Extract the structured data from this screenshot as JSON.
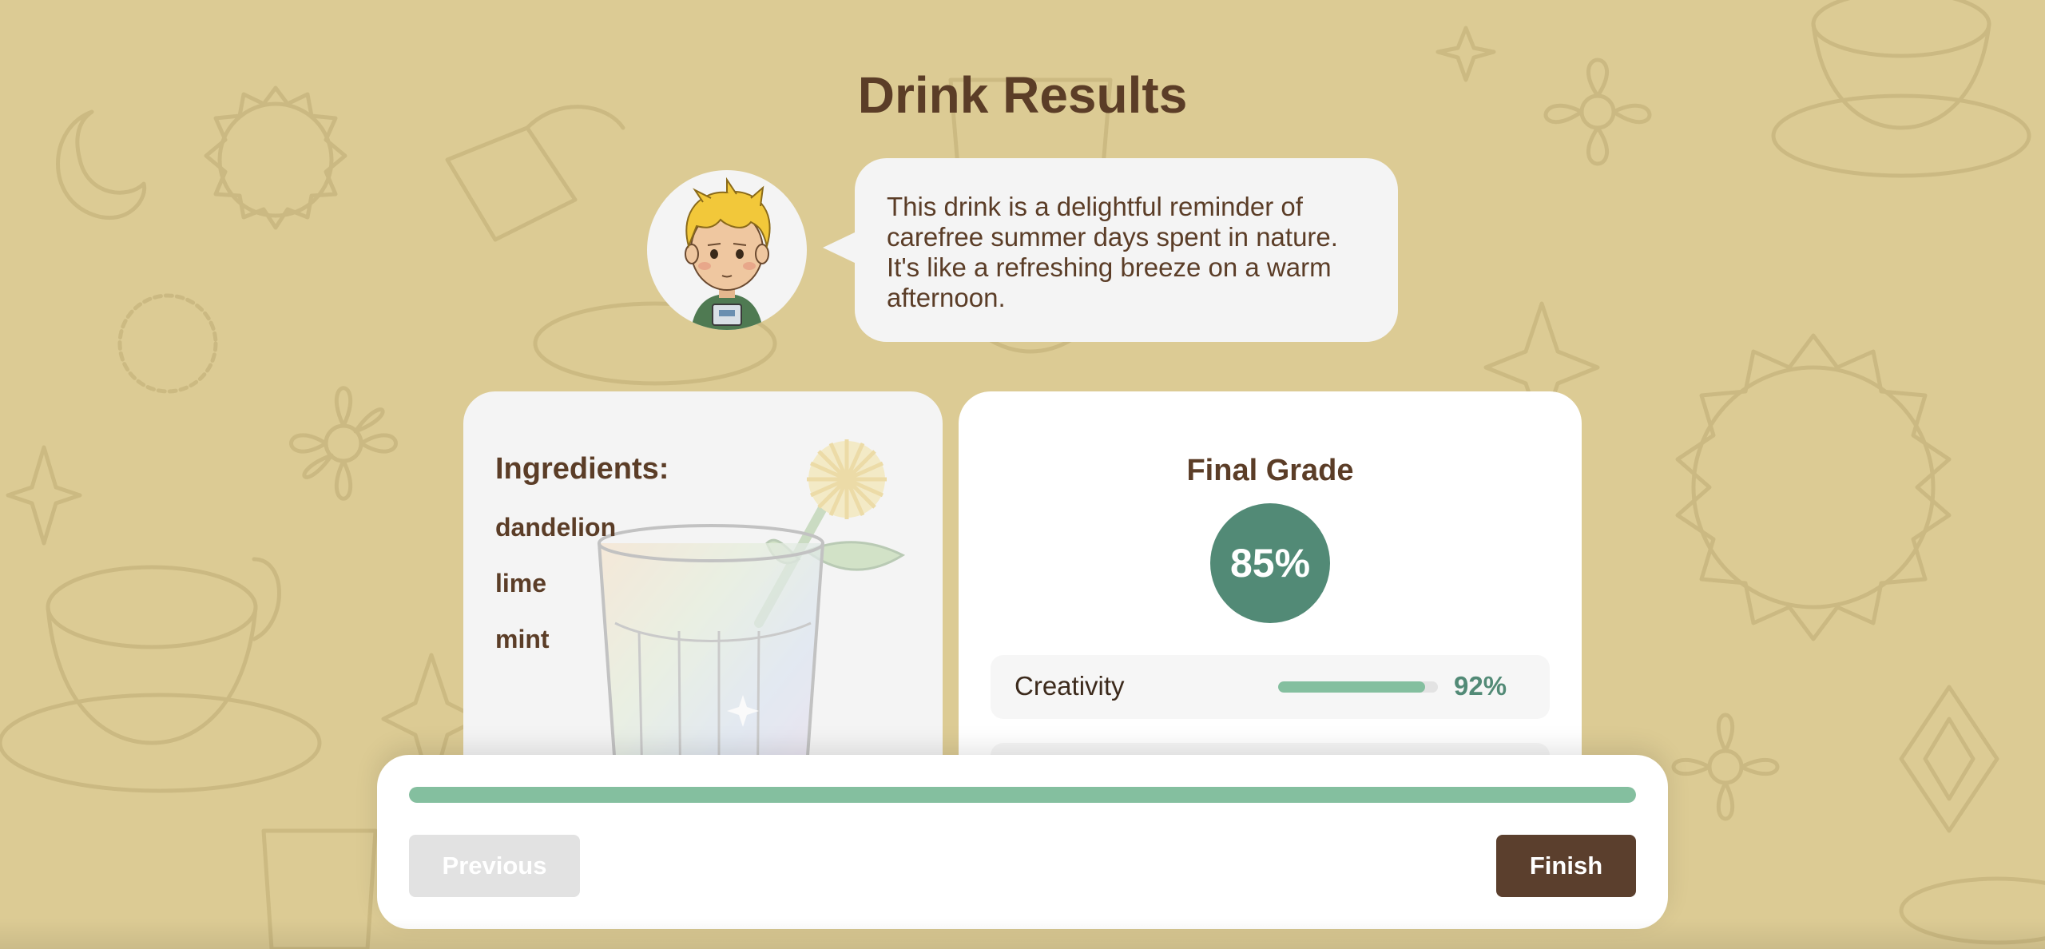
{
  "page": {
    "title": "Drink Results"
  },
  "reviewer": {
    "comment": "This drink is a delightful reminder of carefree summer days spent in nature. It's like a refreshing breeze on a warm afternoon."
  },
  "ingredients": {
    "heading": "Ingredients:",
    "items": [
      "dandelion",
      "lime",
      "mint"
    ]
  },
  "grade": {
    "heading": "Final Grade",
    "value": "85%",
    "criteria": [
      {
        "label": "Creativity",
        "value": "92%",
        "fraction": 0.92
      }
    ]
  },
  "footer": {
    "progress_fraction": 1.0,
    "previous_label": "Previous",
    "finish_label": "Finish"
  },
  "colors": {
    "background": "#dccb94",
    "accent_green": "#528a76",
    "bar_green": "#84bf9f",
    "brown": "#5b3f2d"
  }
}
